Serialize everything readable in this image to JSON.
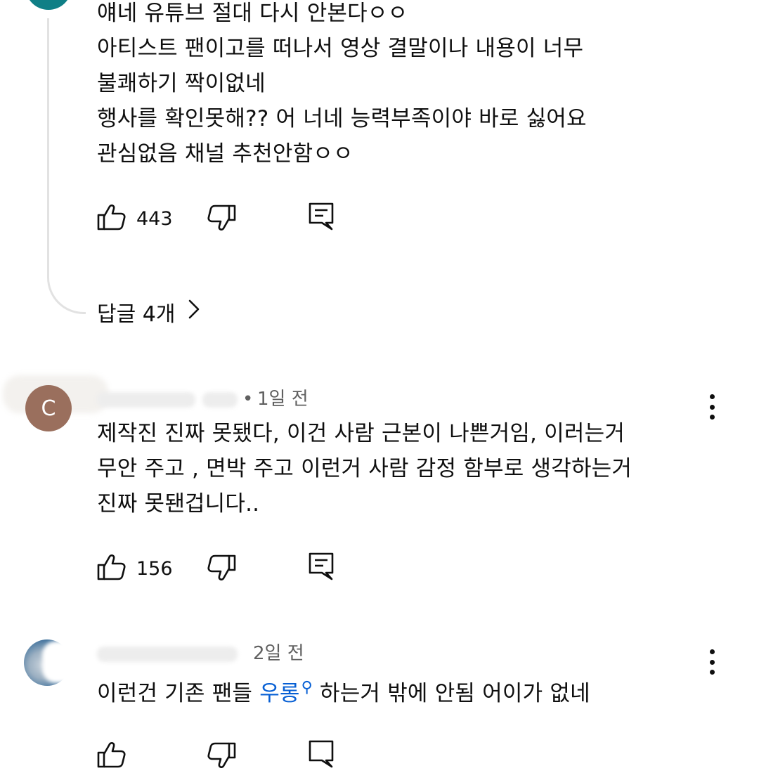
{
  "comments": [
    {
      "lines": [
        "얘네 유튜브 절대 다시 안본다ㅇㅇ",
        "아티스트 팬이고를 떠나서 영상 결말이나 내용이 너무",
        "불쾌하기 짝이없네",
        "행사를 확인못해?? 어 너네 능력부족이야 바로 싫어요",
        "관심없음 채널 추천안함ㅇㅇ"
      ],
      "like_count": "443",
      "replies_label": "답글 4개"
    },
    {
      "avatar_letter": "C",
      "meta": {
        "dot": "•",
        "time": "1일 전"
      },
      "lines": [
        "제작진 진짜 못됐다, 이건 사람 근본이 나쁜거임,  이러는거",
        "무안 주고 , 면박 주고 이런거 사람 감정 함부로 생각하는거",
        "진짜 못됀겁니다.."
      ],
      "like_count": "156"
    },
    {
      "meta": {
        "time": "2일 전"
      },
      "line_prefix": "이런건 기존 팬들 ",
      "line_link": "우롱",
      "line_link_icon": "search-icon",
      "line_suffix": "하는거 밖에 안됨 어이가 없네"
    }
  ],
  "icons": {
    "like": "thumbs-up-icon",
    "dislike": "thumbs-down-icon",
    "reply": "comment-reply-icon",
    "more": "more-vert-icon",
    "chevron": "chevron-right-icon"
  },
  "colors": {
    "text": "#0f0f0f",
    "secondary_text": "#606060",
    "link": "#065fd4",
    "thread_line": "#e2e2e2"
  }
}
